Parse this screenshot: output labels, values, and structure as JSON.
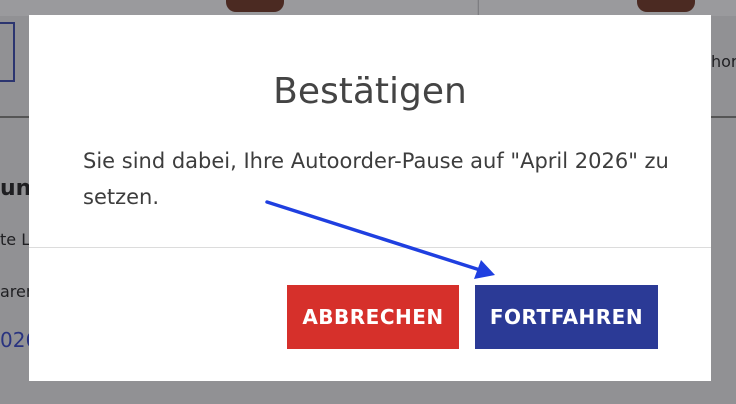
{
  "background": {
    "left_fragments": [
      "un",
      "te L",
      "aren",
      "026"
    ],
    "right_fragment": "hor"
  },
  "dialog": {
    "title": "Bestätigen",
    "message": "Sie sind dabei, Ihre Autoorder-Pause auf \"April 2026\" zu setzen.",
    "cancel_label": "ABBRECHEN",
    "continue_label": "FORTFAHREN"
  },
  "colors": {
    "cancel": "#d6302b",
    "continue": "#2b3a96",
    "annotation_arrow": "#1f3fe0"
  },
  "annotation": {
    "icon": "arrow-pointing-to-continue-button"
  }
}
